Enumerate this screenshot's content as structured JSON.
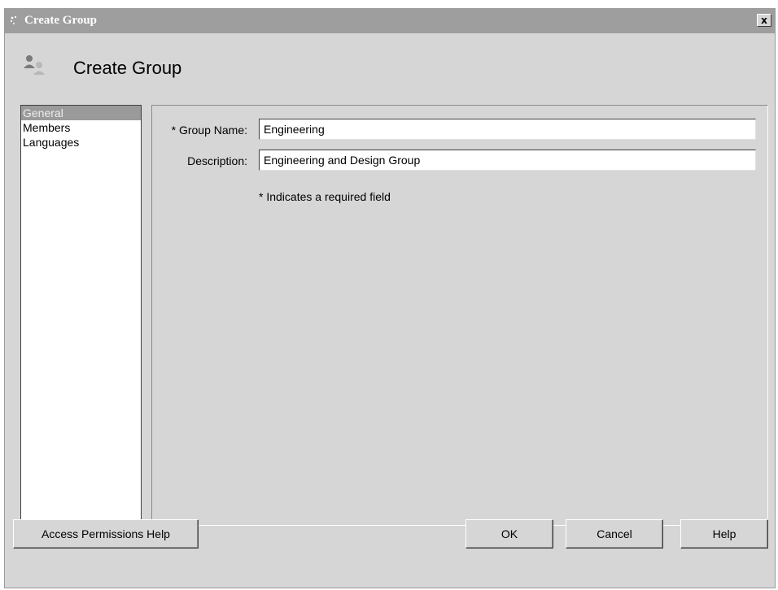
{
  "window": {
    "title": "Create Group",
    "close_label": "x"
  },
  "header": {
    "heading": "Create Group",
    "icon": "group-users-icon"
  },
  "nav": {
    "items": [
      {
        "label": "General",
        "selected": true
      },
      {
        "label": "Members",
        "selected": false
      },
      {
        "label": "Languages",
        "selected": false
      }
    ]
  },
  "form": {
    "group_name": {
      "label": "* Group Name:",
      "value": "Engineering"
    },
    "description": {
      "label": "Description:",
      "value": "Engineering and Design Group"
    },
    "required_hint": "* Indicates a required field"
  },
  "buttons": {
    "access_help": "Access Permissions Help",
    "ok": "OK",
    "cancel": "Cancel",
    "help": "Help"
  },
  "colors": {
    "dialog_bg": "#d6d6d6",
    "titlebar_bg": "#9e9e9e",
    "selected_item_bg": "#9a9a9a"
  }
}
